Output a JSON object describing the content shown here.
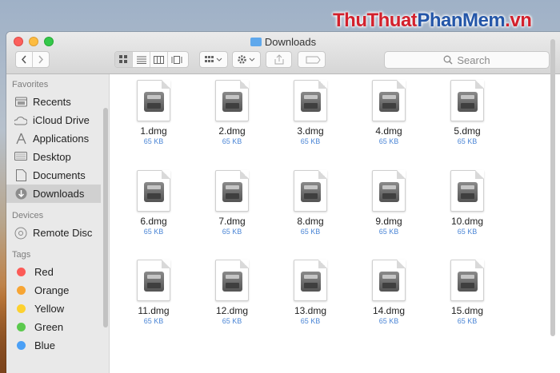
{
  "watermark": {
    "part1": "ThuThuat",
    "part2": "PhanMem",
    "part3": ".vn"
  },
  "window": {
    "title": "Downloads",
    "folder_icon": "folder-icon",
    "search_placeholder": "Search"
  },
  "sidebar": {
    "favorites_header": "Favorites",
    "favorites": [
      {
        "label": "Recents",
        "icon": "clock-icon"
      },
      {
        "label": "iCloud Drive",
        "icon": "cloud-icon"
      },
      {
        "label": "Applications",
        "icon": "applications-icon"
      },
      {
        "label": "Desktop",
        "icon": "desktop-icon"
      },
      {
        "label": "Documents",
        "icon": "document-icon"
      },
      {
        "label": "Downloads",
        "icon": "download-icon",
        "selected": true
      }
    ],
    "devices_header": "Devices",
    "devices": [
      {
        "label": "Remote Disc",
        "icon": "disc-icon"
      }
    ],
    "tags_header": "Tags",
    "tags": [
      {
        "label": "Red",
        "color": "#fc5b57"
      },
      {
        "label": "Orange",
        "color": "#f7a534"
      },
      {
        "label": "Yellow",
        "color": "#fdd12f"
      },
      {
        "label": "Green",
        "color": "#5bc94d"
      },
      {
        "label": "Blue",
        "color": "#4ba0f6"
      }
    ]
  },
  "files": [
    {
      "name": "1.dmg",
      "size": "65 KB"
    },
    {
      "name": "2.dmg",
      "size": "65 KB"
    },
    {
      "name": "3.dmg",
      "size": "65 KB"
    },
    {
      "name": "4.dmg",
      "size": "65 KB"
    },
    {
      "name": "5.dmg",
      "size": "65 KB"
    },
    {
      "name": "6.dmg",
      "size": "65 KB"
    },
    {
      "name": "7.dmg",
      "size": "65 KB"
    },
    {
      "name": "8.dmg",
      "size": "65 KB"
    },
    {
      "name": "9.dmg",
      "size": "65 KB"
    },
    {
      "name": "10.dmg",
      "size": "65 KB"
    },
    {
      "name": "11.dmg",
      "size": "65 KB"
    },
    {
      "name": "12.dmg",
      "size": "65 KB"
    },
    {
      "name": "13.dmg",
      "size": "65 KB"
    },
    {
      "name": "14.dmg",
      "size": "65 KB"
    },
    {
      "name": "15.dmg",
      "size": "65 KB"
    }
  ]
}
